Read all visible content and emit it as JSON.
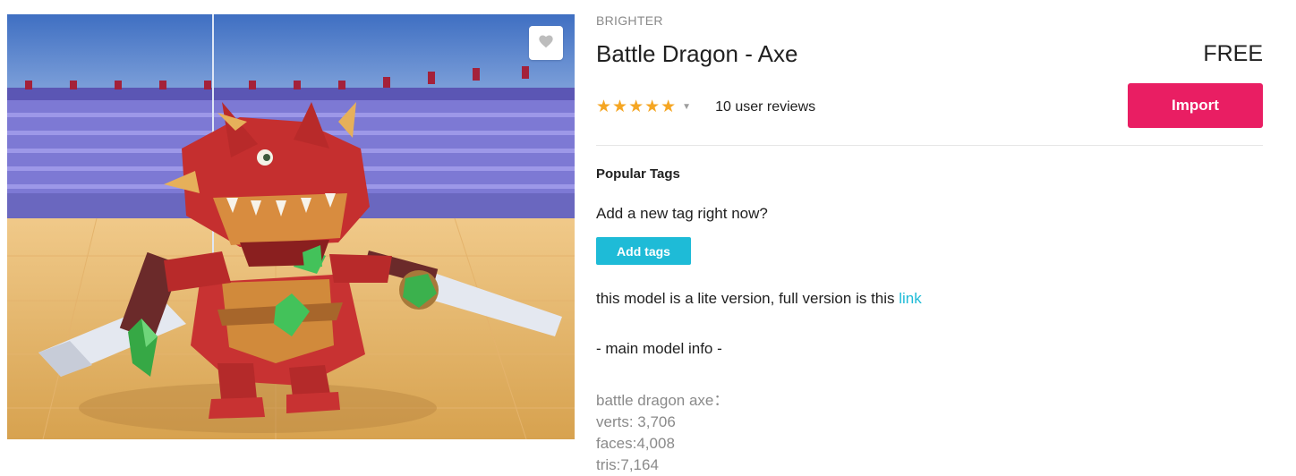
{
  "asset": {
    "publisher": "BRIGHTER",
    "title": "Battle Dragon - Axe",
    "price": "FREE",
    "rating_stars": "★★★★★",
    "rating_value": 5,
    "reviews_label": "10 user reviews",
    "import_label": "Import"
  },
  "tags": {
    "heading": "Popular Tags",
    "prompt": "Add a new tag right now?",
    "add_label": "Add tags"
  },
  "description": {
    "lite_text": "this model is a lite version, full version is this ",
    "link_text": "link",
    "main_info": "- main model info -",
    "stats": [
      "battle dragon axe：",
      "verts: 3,706",
      "faces:4,008",
      "tris:7,164"
    ]
  },
  "icons": {
    "favorite": "heart-icon",
    "rating_menu": "caret-down-icon"
  },
  "colors": {
    "import_button": "#e91e63",
    "accent": "#1ebbd7",
    "stars": "#f5a623"
  }
}
